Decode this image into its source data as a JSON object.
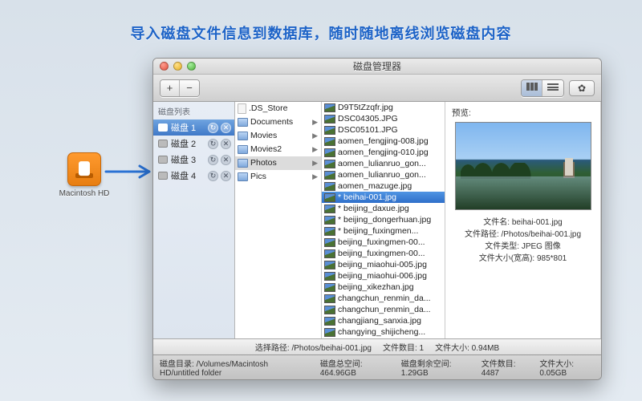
{
  "headline": "导入磁盘文件信息到数据库，随时随地离线浏览磁盘内容",
  "external_drive": {
    "label": "Macintosh HD"
  },
  "window": {
    "title": "磁盘管理器",
    "toolbar": {
      "add": "+",
      "remove": "−"
    }
  },
  "sidebar": {
    "header": "磁盘列表",
    "items": [
      {
        "label": "磁盘 1",
        "selected": true
      },
      {
        "label": "磁盘 2",
        "selected": false
      },
      {
        "label": "磁盘 3",
        "selected": false
      },
      {
        "label": "磁盘 4",
        "selected": false
      }
    ]
  },
  "columns": {
    "col1": [
      {
        "label": ".DS_Store",
        "type": "file"
      },
      {
        "label": "Documents",
        "type": "folder"
      },
      {
        "label": "Movies",
        "type": "folder"
      },
      {
        "label": "Movies2",
        "type": "folder"
      },
      {
        "label": "Photos",
        "type": "folder",
        "selected": true
      },
      {
        "label": "Pics",
        "type": "folder"
      }
    ],
    "col2": [
      {
        "label": "D9T5tZzqfr.jpg"
      },
      {
        "label": "DSC04305.JPG"
      },
      {
        "label": "DSC05101.JPG"
      },
      {
        "label": "aomen_fengjing-008.jpg"
      },
      {
        "label": "aomen_fengjing-010.jpg"
      },
      {
        "label": "aomen_lulianruo_gon..."
      },
      {
        "label": "aomen_lulianruo_gon..."
      },
      {
        "label": "aomen_mazuge.jpg"
      },
      {
        "label": "* beihai-001.jpg",
        "selected": true
      },
      {
        "label": "* beijing_daxue.jpg"
      },
      {
        "label": "* beijing_dongerhuan.jpg"
      },
      {
        "label": "* beijing_fuxingmen..."
      },
      {
        "label": "beijing_fuxingmen-00..."
      },
      {
        "label": "beijing_fuxingmen-00..."
      },
      {
        "label": "beijing_miaohui-005.jpg"
      },
      {
        "label": "beijing_miaohui-006.jpg"
      },
      {
        "label": "beijing_xikezhan.jpg"
      },
      {
        "label": "changchun_renmin_da..."
      },
      {
        "label": "changchun_renmin_da..."
      },
      {
        "label": "changjiang_sanxia.jpg"
      },
      {
        "label": "changying_shijicheng..."
      }
    ]
  },
  "preview": {
    "header": "预览:",
    "meta": {
      "name_k": "文件名:",
      "name_v": "beihai-001.jpg",
      "path_k": "文件路径:",
      "path_v": "/Photos/beihai-001.jpg",
      "type_k": "文件类型:",
      "type_v": "JPEG 图像",
      "size_k": "文件大小(宽高):",
      "size_v": "985*801"
    }
  },
  "status_upper": {
    "sel_path_k": "选择路径:",
    "sel_path_v": "/Photos/beihai-001.jpg",
    "file_count_k": "文件数目:",
    "file_count_v": "1",
    "file_size_k": "文件大小:",
    "file_size_v": "0.94MB"
  },
  "status_lower": {
    "disk_dir_k": "磁盘目录:",
    "disk_dir_v": "/Volumes/Macintosh HD/untitled folder",
    "disk_total_k": "磁盘总空间:",
    "disk_total_v": "464.96GB",
    "disk_free_k": "磁盘剩余空间:",
    "disk_free_v": "1.29GB",
    "file_count_k": "文件数目:",
    "file_count_v": "4487",
    "file_size_k": "文件大小:",
    "file_size_v": "0.05GB"
  }
}
